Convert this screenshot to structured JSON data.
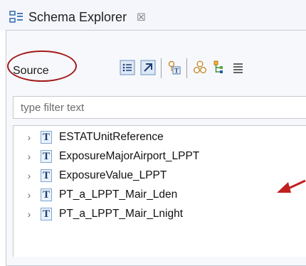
{
  "view_tab": {
    "title": "Schema Explorer",
    "close_symbol": "☒"
  },
  "toolbar": {
    "source_label": "Source"
  },
  "filter": {
    "placeholder": "type filter text",
    "value": ""
  },
  "tree": {
    "items": [
      {
        "label": "ESTATUnitReference",
        "type_glyph": "T",
        "expander": "›"
      },
      {
        "label": "ExposureMajorAirport_LPPT",
        "type_glyph": "T",
        "expander": "›"
      },
      {
        "label": "ExposureValue_LPPT",
        "type_glyph": "T",
        "expander": "›"
      },
      {
        "label": "PT_a_LPPT_Mair_Lden",
        "type_glyph": "T",
        "expander": "›"
      },
      {
        "label": "PT_a_LPPT_Mair_Lnight",
        "type_glyph": "T",
        "expander": "›"
      }
    ]
  },
  "colors": {
    "annotation_red": "#c0201e",
    "icon_blue": "#1d5fa8",
    "icon_green": "#3b8a2e",
    "panel_border": "#c5c9d0"
  },
  "icons": {
    "view_icon": "schema-explorer-icon",
    "toolbar": [
      "list-view-icon",
      "collapse-all-icon",
      "type-structure-icon",
      "link-icon",
      "hierarchy-icon",
      "details-icon"
    ],
    "annotation": "arrow-pointer-icon"
  }
}
